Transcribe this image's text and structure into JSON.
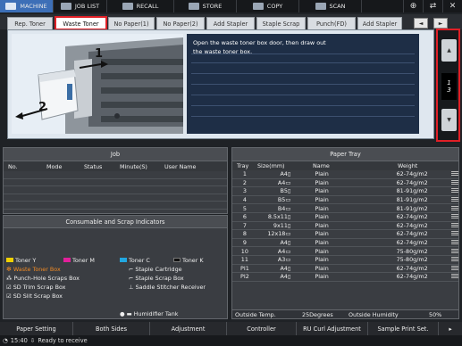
{
  "top_tabs": [
    {
      "label": "MACHINE",
      "icon": "printer-icon",
      "active": true
    },
    {
      "label": "JOB LIST",
      "icon": "job-list-icon"
    },
    {
      "label": "RECALL",
      "icon": "recall-icon"
    },
    {
      "label": "STORE",
      "icon": "store-icon"
    },
    {
      "label": "COPY",
      "icon": "copy-icon"
    },
    {
      "label": "SCAN",
      "icon": "scan-icon"
    }
  ],
  "top_buttons": {
    "globe": "⊕",
    "nav": "⇄",
    "close": "✕"
  },
  "sub_tabs": [
    "Rep. Toner",
    "Waste Toner",
    "No Paper(1)",
    "No Paper(2)",
    "Add Stapler",
    "Staple Scrap",
    "Punch(FD)",
    "Add Stapler"
  ],
  "sub_nav": {
    "prev": "◄",
    "next": "►"
  },
  "message": {
    "line1": "Open the waste toner box door, then draw out",
    "line2": "the waste toner box."
  },
  "illustration": {
    "step1": "1",
    "step2": "2"
  },
  "pager": {
    "up": "▲",
    "down": "▼",
    "current": "1",
    "total": "3"
  },
  "job": {
    "title": "Job",
    "columns": [
      "No.",
      "Mode",
      "Status",
      "Minute(S)",
      "User Name"
    ]
  },
  "consumables": {
    "title": "Consumable and Scrap Indicators",
    "items": [
      {
        "label": "Toner Y",
        "color": "#f0d000"
      },
      {
        "label": "Toner M",
        "color": "#e0209a"
      },
      {
        "label": "Toner C",
        "color": "#22a7e0"
      },
      {
        "label": "Toner K",
        "color": "#111111"
      },
      {
        "label": "Waste Toner Box",
        "color": "#f08a24",
        "alert": true
      },
      {
        "label": "Staple Cartridge"
      },
      {
        "label": "Punch-Hole Scraps Box"
      },
      {
        "label": "Staple Scrap Box"
      },
      {
        "label": "SD Trim Scrap Box"
      },
      {
        "label": "Saddle Stitcher Receiver"
      },
      {
        "label": "SD Slit Scrap Box"
      },
      {
        "label": "Humidifier Tank"
      }
    ]
  },
  "paper_tray": {
    "title": "Paper Tray",
    "columns": [
      "Tray",
      "Size(mm)",
      "Name",
      "Weight"
    ],
    "rows": [
      [
        "1",
        "A4▯",
        "Plain",
        "62-74g/m2"
      ],
      [
        "2",
        "A4▭",
        "Plain",
        "62-74g/m2"
      ],
      [
        "3",
        "B5▯",
        "Plain",
        "81-91g/m2"
      ],
      [
        "4",
        "B5▭",
        "Plain",
        "81-91g/m2"
      ],
      [
        "5",
        "B4▭",
        "Plain",
        "81-91g/m2"
      ],
      [
        "6",
        "8.5x11▯",
        "Plain",
        "62-74g/m2"
      ],
      [
        "7",
        "9x11▯",
        "Plain",
        "62-74g/m2"
      ],
      [
        "8",
        "12x18▭",
        "Plain",
        "62-74g/m2"
      ],
      [
        "9",
        "A4▯",
        "Plain",
        "62-74g/m2"
      ],
      [
        "10",
        "A4▭",
        "Plain",
        "75-80g/m2"
      ],
      [
        "11",
        "A3▭",
        "Plain",
        "75-80g/m2"
      ],
      [
        "PI1",
        "A4▯",
        "Plain",
        "62-74g/m2"
      ],
      [
        "PI2",
        "A4▯",
        "Plain",
        "62-74g/m2"
      ]
    ],
    "outside_temp_label": "Outside Temp.",
    "outside_temp_value": "25Degrees",
    "outside_humidity_label": "Outside Humidity",
    "outside_humidity_value": "50%"
  },
  "footer": [
    "Paper Setting",
    "Both Sides",
    "Adjustment",
    "Controller",
    "RU Curl Adjustment",
    "Sample Print Set."
  ],
  "status": {
    "time": "15:40",
    "text": "Ready to receive"
  }
}
